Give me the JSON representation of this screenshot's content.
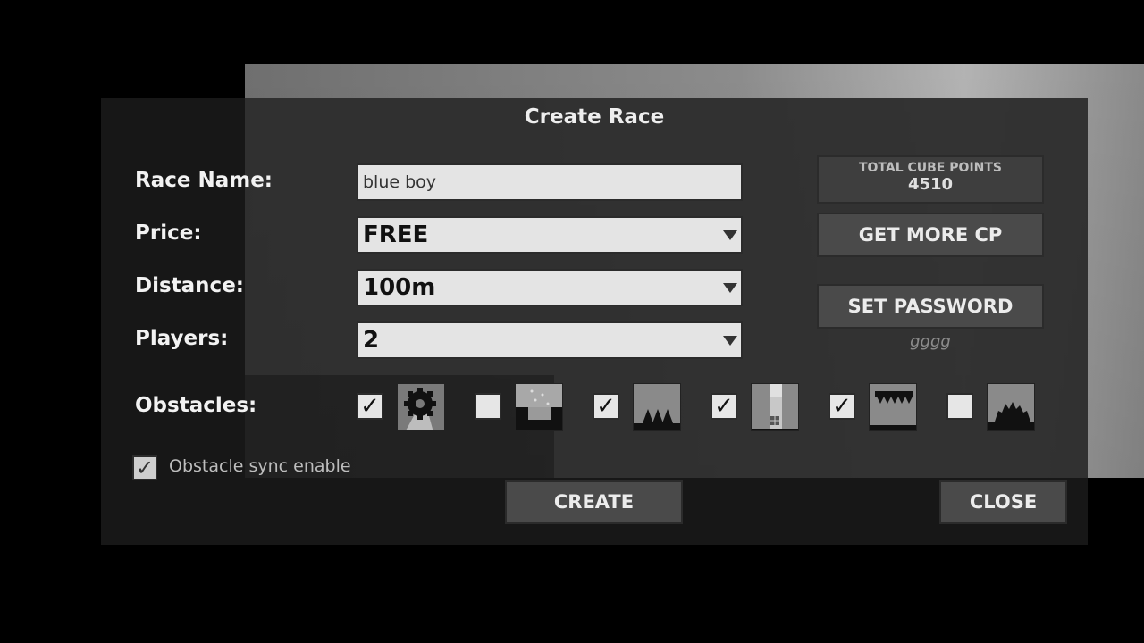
{
  "dialog": {
    "title": "Create Race"
  },
  "form": {
    "race_name_label": "Race Name:",
    "race_name_value": "blue boy",
    "price_label": "Price:",
    "price_value": "FREE",
    "distance_label": "Distance:",
    "distance_value": "100m",
    "players_label": "Players:",
    "players_value": "2",
    "obstacles_label": "Obstacles:"
  },
  "side_panel": {
    "cp_label": "TOTAL CUBE POINTS",
    "cp_value": "4510",
    "get_more_label": "GET MORE CP",
    "set_password_label": "SET PASSWORD",
    "password_value": "gggg"
  },
  "obstacles": [
    {
      "checked": true,
      "check_mark": "✓",
      "icon": "gear-saw-obstacle-icon"
    },
    {
      "checked": false,
      "check_mark": "",
      "icon": "falling-blocks-obstacle-icon"
    },
    {
      "checked": true,
      "check_mark": "✓",
      "icon": "floor-spikes-obstacle-icon"
    },
    {
      "checked": true,
      "check_mark": "✓",
      "icon": "pillar-obstacle-icon"
    },
    {
      "checked": true,
      "check_mark": "✓",
      "icon": "ceiling-spikes-obstacle-icon"
    },
    {
      "checked": false,
      "check_mark": "",
      "icon": "spiky-mound-obstacle-icon"
    }
  ],
  "sync": {
    "checked": true,
    "check_mark": "✓",
    "label": "Obstacle sync enable"
  },
  "buttons": {
    "create": "CREATE",
    "close": "CLOSE"
  }
}
